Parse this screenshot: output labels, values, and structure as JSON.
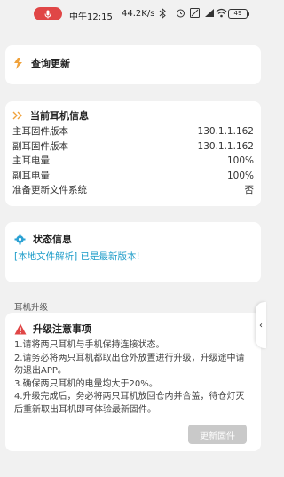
{
  "status_bar": {
    "time": "中午12:15",
    "speed": "44.2K/s",
    "battery": "49"
  },
  "check_update": {
    "title": "查询更新",
    "icon": "refresh-icon"
  },
  "current_info": {
    "title": "当前耳机信息",
    "icon": "double-chevron-icon",
    "rows": [
      {
        "label": "主耳固件版本",
        "value": "130.1.1.162"
      },
      {
        "label": "副耳固件版本",
        "value": "130.1.1.162"
      },
      {
        "label": "主耳电量",
        "value": "100%"
      },
      {
        "label": "副耳电量",
        "value": "100%"
      },
      {
        "label": "准备更新文件系统",
        "value": "否"
      }
    ]
  },
  "status_info": {
    "title": "状态信息",
    "icon": "gear-icon",
    "message": "[本地文件解析] 已是最新版本!"
  },
  "upgrade": {
    "section_label": "耳机升级",
    "title": "升级注意事项",
    "icon": "warning-icon",
    "notes": [
      "1.请将两只耳机与手机保持连接状态。",
      "2.请务必将两只耳机都取出仓外放置进行升级，升级途中请勿退出APP。",
      "3.确保两只耳机的电量均大于20%。",
      "4.升级完成后，务必将两只耳机放回仓内并合盖，待仓灯灭后重新取出耳机即可体验最新固件。"
    ],
    "button_label": "更新固件"
  },
  "colors": {
    "accent_orange": "#f0a23c",
    "link_blue": "#1a9bc8",
    "warning_red": "#e04646",
    "disabled_button": "#c9c9c9"
  }
}
